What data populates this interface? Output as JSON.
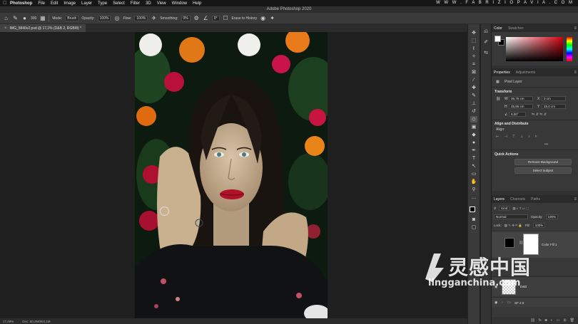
{
  "menubar": {
    "app": "Photoshop",
    "items": [
      "File",
      "Edit",
      "Image",
      "Layer",
      "Type",
      "Select",
      "Filter",
      "3D",
      "View",
      "Window",
      "Help"
    ],
    "watermark": "W W W . F A B R I Z I O P A V I A . C O M"
  },
  "window": {
    "title": "Adobe Photoshop 2020"
  },
  "options": {
    "brush_size": "300",
    "mode_label": "Mode:",
    "mode_value": "Brush",
    "opacity_label": "Opacity:",
    "opacity_value": "100%",
    "flow_label": "Flow:",
    "flow_value": "100%",
    "smoothing_label": "Smoothing:",
    "smoothing_value": "0%",
    "angle_value": "0°",
    "erase_history_label": "Erase to History"
  },
  "document": {
    "tab_label": "IMG_5840v2.psd @ 17,1% (D&B 2, RGB/8) *",
    "zoom": "17,08%",
    "doc_info": "Doc: 80,2M/804,1M"
  },
  "panels": {
    "color": {
      "tabs": [
        "Color",
        "Swatches"
      ]
    },
    "properties": {
      "tabs": [
        "Properties",
        "Adjustments"
      ],
      "layer_type": "Pixel Layer",
      "transform_header": "Transform",
      "w_label": "W",
      "w_value": "36,76 cm",
      "x_label": "X",
      "x_value": "0 cm",
      "h_label": "H",
      "h_value": "25,95 cm",
      "y_label": "Y",
      "y_value": "25,0 cm",
      "angle_value": "0,00°",
      "align_header": "Align and Distribute",
      "align_label": "Align:",
      "quick_header": "Quick Actions",
      "remove_bg_label": "Remove Background",
      "select_subject_label": "Select Subject"
    },
    "layers": {
      "tabs": [
        "Layers",
        "Channels",
        "Paths"
      ],
      "kind_label": "Kind",
      "blend_mode": "Normal",
      "opacity_label": "Opacity:",
      "opacity_value": "100%",
      "lock_label": "Lock:",
      "fill_label": "Fill:",
      "fill_value": "100%",
      "items": [
        {
          "name": "Color Fill 1"
        },
        {
          "name": "D&B"
        },
        {
          "name": "SF 2.0"
        }
      ]
    }
  },
  "brand": {
    "logo_text": "灵感中国",
    "url": "lingganchina.com"
  },
  "colors": {
    "panel_bg": "#383838",
    "canvas_bg": "#1f1f1f",
    "lip_red": "#b0122a"
  }
}
